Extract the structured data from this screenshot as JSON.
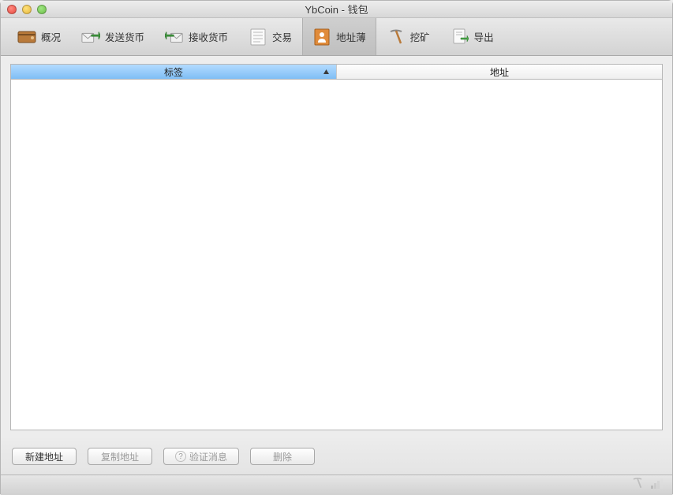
{
  "window": {
    "title": "YbCoin - 钱包"
  },
  "toolbar": {
    "items": [
      {
        "label": "概况"
      },
      {
        "label": "发送货币"
      },
      {
        "label": "接收货币"
      },
      {
        "label": "交易"
      },
      {
        "label": "地址薄"
      },
      {
        "label": "挖矿"
      },
      {
        "label": "导出"
      }
    ],
    "active_index": 4
  },
  "table": {
    "columns": [
      {
        "label": "标签",
        "sorted": true,
        "sort_dir": "asc"
      },
      {
        "label": "地址",
        "sorted": false
      }
    ],
    "rows": []
  },
  "buttons": {
    "new_address": "新建地址",
    "copy_address": "复制地址",
    "verify_message": "验证消息",
    "delete": "删除",
    "help_symbol": "?"
  }
}
